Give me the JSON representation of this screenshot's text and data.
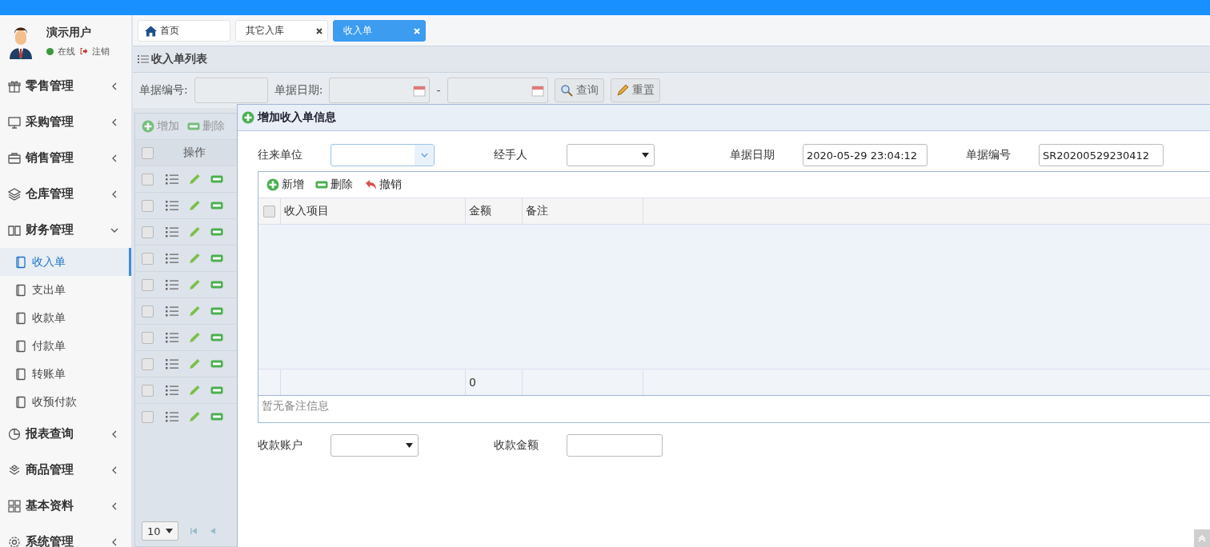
{
  "user": {
    "name": "演示用户",
    "status": "在线",
    "logout": "注销"
  },
  "menu": [
    {
      "label": "零售管理",
      "expanded": false
    },
    {
      "label": "采购管理",
      "expanded": false
    },
    {
      "label": "销售管理",
      "expanded": false
    },
    {
      "label": "仓库管理",
      "expanded": false
    },
    {
      "label": "财务管理",
      "expanded": true,
      "children": [
        {
          "label": "收入单",
          "selected": true
        },
        {
          "label": "支出单",
          "selected": false
        },
        {
          "label": "收款单",
          "selected": false
        },
        {
          "label": "付款单",
          "selected": false
        },
        {
          "label": "转账单",
          "selected": false
        },
        {
          "label": "收预付款",
          "selected": false
        }
      ]
    },
    {
      "label": "报表查询",
      "expanded": false
    },
    {
      "label": "商品管理",
      "expanded": false
    },
    {
      "label": "基本资料",
      "expanded": false
    },
    {
      "label": "系统管理",
      "expanded": false
    }
  ],
  "tabs": [
    {
      "label": "首页",
      "kind": "home",
      "selected": false
    },
    {
      "label": "其它入库",
      "kind": "page",
      "selected": false
    },
    {
      "label": "收入单",
      "kind": "page",
      "selected": true
    }
  ],
  "list_panel": {
    "title": "收入单列表",
    "search": {
      "number_label": "单据编号:",
      "date_label": "单据日期:",
      "date_separator": "-",
      "buttons": [
        {
          "label": "查询",
          "kind": "search"
        },
        {
          "label": "重置",
          "kind": "reset"
        }
      ]
    },
    "toolbar": [
      {
        "label": "增加",
        "kind": "add"
      },
      {
        "label": "删除",
        "kind": "remove"
      }
    ],
    "grid": {
      "columns": [
        "操作"
      ],
      "all_checked": false,
      "rows": [
        {
          "checked": false
        },
        {
          "checked": false
        },
        {
          "checked": false
        },
        {
          "checked": false
        },
        {
          "checked": false
        },
        {
          "checked": false
        },
        {
          "checked": false
        },
        {
          "checked": false
        },
        {
          "checked": false
        },
        {
          "checked": false
        }
      ]
    },
    "pager": {
      "page_size": "10"
    }
  },
  "dialog": {
    "title": "增加收入单信息",
    "fields": [
      {
        "label": "往来单位",
        "kind": "combo"
      },
      {
        "label": "经手人",
        "kind": "select"
      },
      {
        "label": "单据日期",
        "kind": "text",
        "value": "2020-05-29 23:04:12"
      },
      {
        "label": "单据编号",
        "kind": "text",
        "value": "SR20200529230412"
      }
    ],
    "toolbar": [
      {
        "label": "新增",
        "kind": "add"
      },
      {
        "label": "删除",
        "kind": "remove"
      },
      {
        "label": "撤销",
        "kind": "undo"
      }
    ],
    "grid": {
      "columns": [
        "收入项目",
        "金额",
        "备注"
      ],
      "all_checked": false,
      "total_amount": "0"
    },
    "remarks": {
      "placeholder": "暂无备注信息"
    },
    "payment_fields": [
      {
        "label": "收款账户",
        "kind": "select"
      },
      {
        "label": "收款金额",
        "kind": "text"
      }
    ]
  }
}
